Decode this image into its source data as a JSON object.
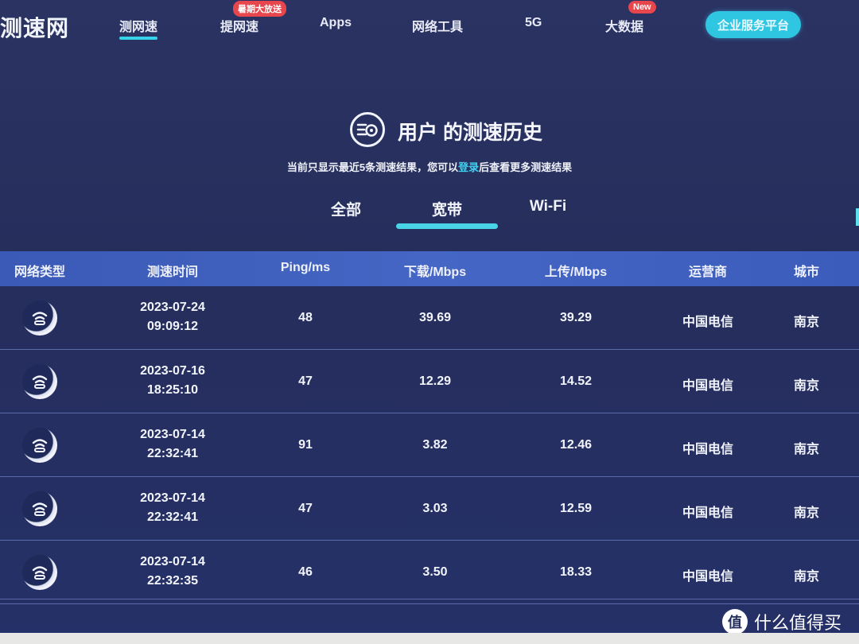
{
  "nav": {
    "logo": "测速网",
    "items": [
      {
        "label": "测网速",
        "active": true
      },
      {
        "label": "提网速",
        "badge": "暑期大放送"
      },
      {
        "label": "Apps"
      },
      {
        "label": "网络工具"
      },
      {
        "label": "5G"
      },
      {
        "label": "大数据",
        "badge": "New"
      }
    ],
    "enterprise_button": "企业服务平台"
  },
  "hero": {
    "icon": "speed-history-icon",
    "title": "用户 的测速历史",
    "subtitle_before": "当前只显示最近5条测速结果，您可以",
    "subtitle_link": "登录",
    "subtitle_after": "后查看更多测速结果"
  },
  "tabs": [
    {
      "label": "全部",
      "active": false
    },
    {
      "label": "宽带",
      "active": true
    },
    {
      "label": "Wi-Fi",
      "active": false
    }
  ],
  "table": {
    "columns": [
      "网络类型",
      "测速时间",
      "Ping/ms",
      "下载/Mbps",
      "上传/Mbps",
      "运营商",
      "城市"
    ],
    "rows": [
      {
        "type_icon": "broadband-icon",
        "date": "2023-07-24",
        "time": "09:09:12",
        "ping": "48",
        "download": "39.69",
        "upload": "39.29",
        "isp": "中国电信",
        "city": "南京"
      },
      {
        "type_icon": "broadband-icon",
        "date": "2023-07-16",
        "time": "18:25:10",
        "ping": "47",
        "download": "12.29",
        "upload": "14.52",
        "isp": "中国电信",
        "city": "南京"
      },
      {
        "type_icon": "broadband-icon",
        "date": "2023-07-14",
        "time": "22:32:41",
        "ping": "91",
        "download": "3.82",
        "upload": "12.46",
        "isp": "中国电信",
        "city": "南京"
      },
      {
        "type_icon": "broadband-icon",
        "date": "2023-07-14",
        "time": "22:32:41",
        "ping": "47",
        "download": "3.03",
        "upload": "12.59",
        "isp": "中国电信",
        "city": "南京"
      },
      {
        "type_icon": "broadband-icon",
        "date": "2023-07-14",
        "time": "22:32:35",
        "ping": "46",
        "download": "3.50",
        "upload": "18.33",
        "isp": "中国电信",
        "city": "南京"
      }
    ]
  },
  "watermark": {
    "logo_char": "值",
    "text": "什么值得买"
  },
  "colors": {
    "accent": "#36d2ea",
    "badge": "#e8464d",
    "header_bar": "#4566c4",
    "background": "#272f5e"
  }
}
